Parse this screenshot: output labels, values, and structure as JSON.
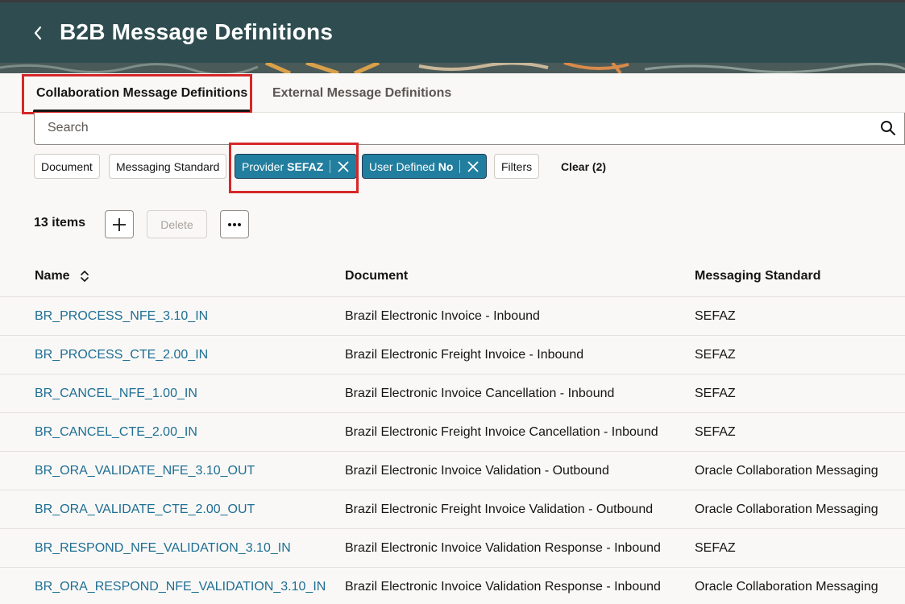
{
  "header": {
    "title": "B2B Message Definitions",
    "back_icon": "chevron-left-icon"
  },
  "tabs": [
    {
      "label": "Collaboration Message Definitions",
      "selected": true
    },
    {
      "label": "External Message Definitions",
      "selected": false
    }
  ],
  "search": {
    "placeholder": "Search",
    "value": "",
    "icon": "search-icon"
  },
  "filters": {
    "chips": [
      {
        "label": "Document"
      },
      {
        "label": "Messaging Standard"
      },
      {
        "label": "Provider",
        "value": "SEFAZ",
        "active": true
      },
      {
        "label": "User Defined",
        "value": "No",
        "active": true
      },
      {
        "label": "Filters"
      }
    ],
    "clear_label": "Clear (2)"
  },
  "toolbar": {
    "count_label": "13 items",
    "delete_label": "Delete",
    "add_icon": "plus-icon",
    "more_icon": "more-horizontal-icon"
  },
  "table": {
    "columns": [
      "Name",
      "Document",
      "Messaging Standard"
    ],
    "rows": [
      {
        "name": "BR_PROCESS_NFE_3.10_IN",
        "document": "Brazil Electronic Invoice - Inbound",
        "standard": "SEFAZ"
      },
      {
        "name": "BR_PROCESS_CTE_2.00_IN",
        "document": "Brazil Electronic Freight Invoice - Inbound",
        "standard": "SEFAZ"
      },
      {
        "name": "BR_CANCEL_NFE_1.00_IN",
        "document": "Brazil Electronic Invoice Cancellation - Inbound",
        "standard": "SEFAZ"
      },
      {
        "name": "BR_CANCEL_CTE_2.00_IN",
        "document": "Brazil Electronic Freight Invoice Cancellation - Inbound",
        "standard": "SEFAZ"
      },
      {
        "name": "BR_ORA_VALIDATE_NFE_3.10_OUT",
        "document": "Brazil Electronic Invoice Validation - Outbound",
        "standard": "Oracle Collaboration Messaging"
      },
      {
        "name": "BR_ORA_VALIDATE_CTE_2.00_OUT",
        "document": "Brazil Electronic Freight Invoice Validation - Outbound",
        "standard": "Oracle Collaboration Messaging"
      },
      {
        "name": "BR_RESPOND_NFE_VALIDATION_3.10_IN",
        "document": "Brazil Electronic Invoice Validation Response - Inbound",
        "standard": "SEFAZ"
      },
      {
        "name": "BR_ORA_RESPOND_NFE_VALIDATION_3.10_IN",
        "document": "Brazil Electronic Invoice Validation Response - Inbound",
        "standard": "Oracle Collaboration Messaging"
      }
    ]
  },
  "colors": {
    "header_band": "#2f4d50",
    "active_chip": "#227e9e",
    "link": "#1e6e94",
    "highlight": "#d62728"
  }
}
